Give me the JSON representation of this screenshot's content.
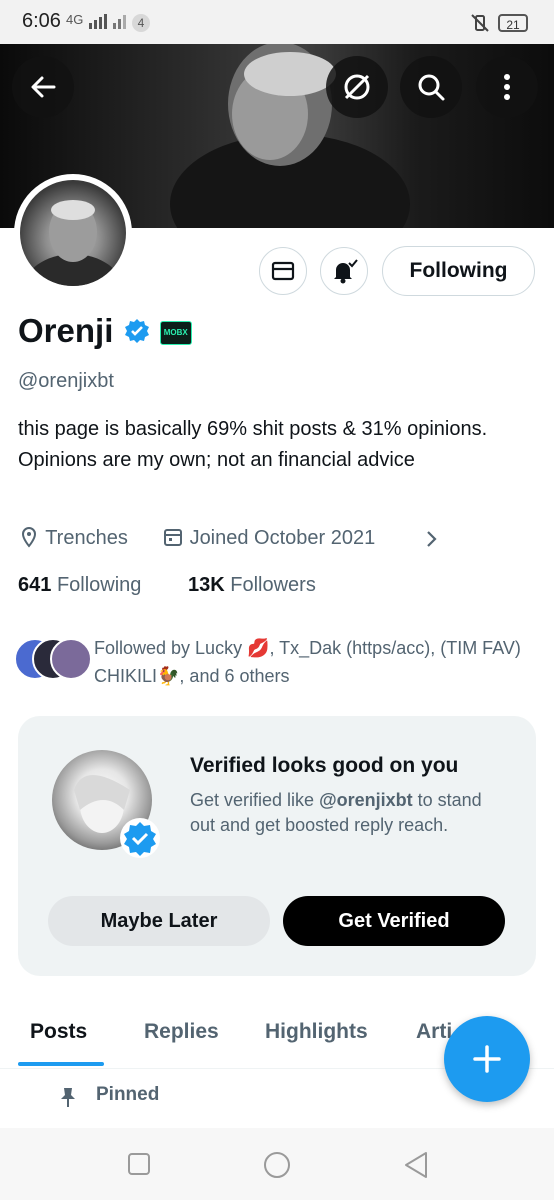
{
  "status_bar": {
    "time": "6:06",
    "network": "4G",
    "notification_count": "4",
    "battery": "21"
  },
  "profile": {
    "name": "Orenji",
    "handle": "@orenjixbt",
    "badge_text": "MOBX",
    "bio": "this page is basically 69% shit posts & 31% opinions. Opinions are my own; not an financial advice",
    "location": "Trenches",
    "joined": "Joined October 2021",
    "following_count": "641",
    "following_label": "Following",
    "followers_count": "13K",
    "followers_label": "Followers",
    "followed_by": "Followed by Lucky 💋, Tx_Dak (https/acc), (TIM FAV) CHIKILI🐓, and 6 others"
  },
  "actions": {
    "following_button": "Following"
  },
  "verified_card": {
    "title": "Verified looks good on you",
    "text_before": "Get verified like ",
    "text_handle": "@orenjixbt",
    "text_after": " to stand out and get boosted reply reach.",
    "maybe_later": "Maybe Later",
    "get_verified": "Get Verified"
  },
  "tabs": [
    "Posts",
    "Replies",
    "Highlights",
    "Arti"
  ],
  "pinned_label": "Pinned",
  "colors": {
    "accent": "#1d9bf0",
    "text": "#0f1419",
    "secondary": "#536471",
    "card_bg": "#eff3f4"
  },
  "icons": [
    "back-arrow-icon",
    "no-connection-icon",
    "search-icon",
    "more-vertical-icon",
    "mail-icon",
    "bell-check-icon",
    "location-pin-icon",
    "calendar-icon",
    "chevron-right-icon",
    "verified-badge-icon",
    "plus-icon",
    "pin-icon"
  ]
}
